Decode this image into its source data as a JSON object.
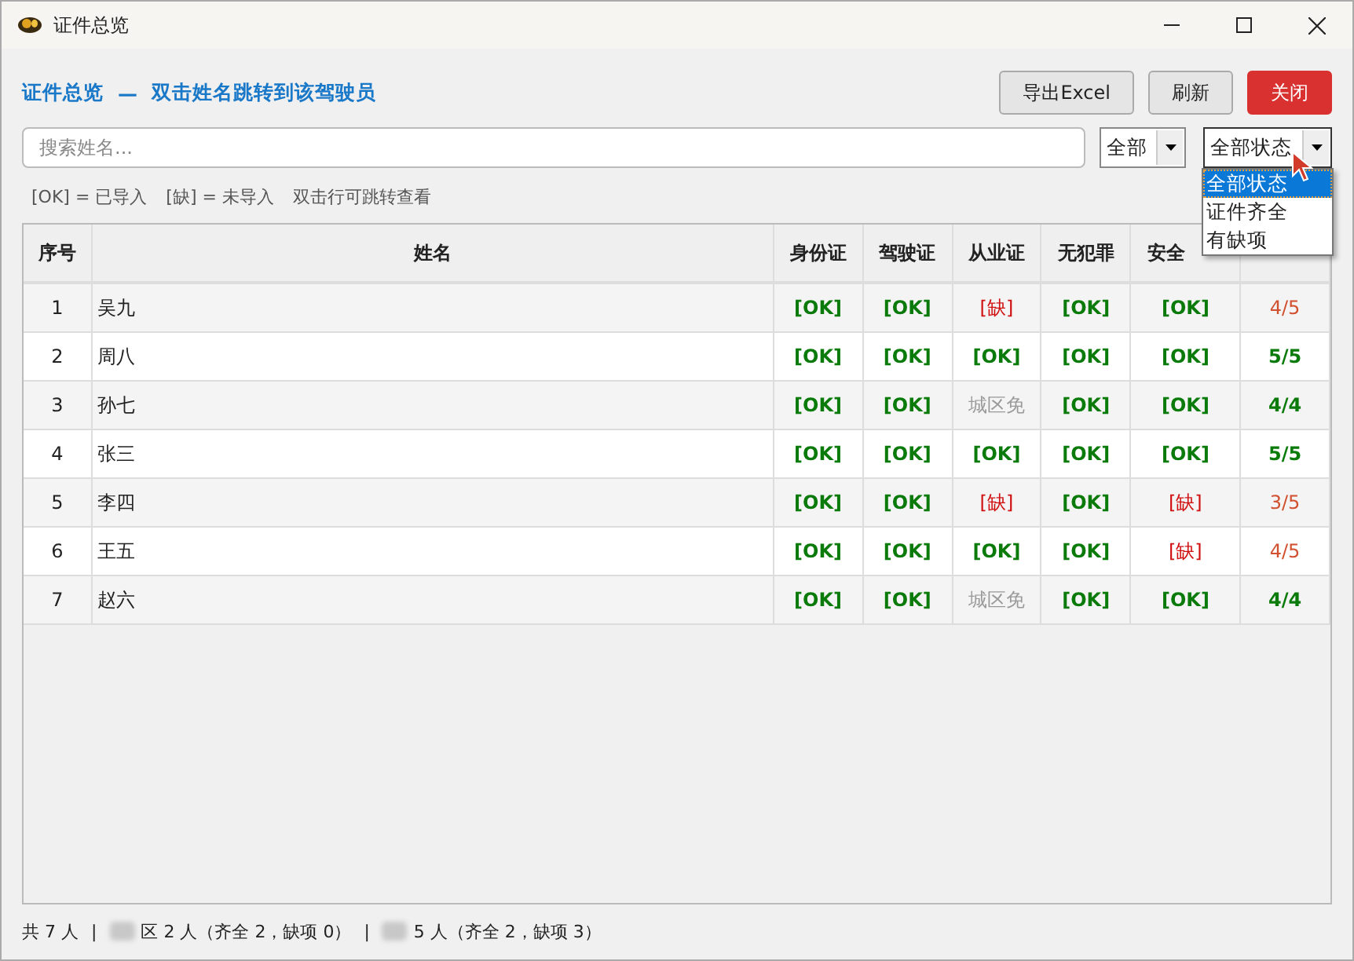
{
  "window": {
    "title": "证件总览"
  },
  "header": {
    "title": "证件总览",
    "separator": "—",
    "subtitle": "双击姓名跳转到该驾驶员"
  },
  "buttons": [
    {
      "label": "导出Excel",
      "kind": "normal"
    },
    {
      "label": "刷新",
      "kind": "normal"
    },
    {
      "label": "关闭",
      "kind": "danger"
    }
  ],
  "search": {
    "placeholder": "搜索姓名..."
  },
  "filters": [
    {
      "value": "全部",
      "expanded": false
    },
    {
      "value": "全部状态",
      "expanded": true,
      "options": [
        {
          "label": "全部状态",
          "selected": true
        },
        {
          "label": "证件齐全",
          "selected": false
        },
        {
          "label": "有缺项",
          "selected": false
        }
      ]
    }
  ],
  "legend": [
    "[OK] = 已导入",
    "[缺] = 未导入",
    "双击行可跳转查看"
  ],
  "table": {
    "columns": [
      "序号",
      "姓名",
      "身份证",
      "驾驶证",
      "从业证",
      "无犯罪",
      "安全"
    ],
    "rows": [
      {
        "cells": [
          {
            "text": "1",
            "kind": "index"
          },
          {
            "text": "吴九",
            "kind": "name"
          },
          {
            "text": "[OK]",
            "kind": "ok"
          },
          {
            "text": "[OK]",
            "kind": "ok"
          },
          {
            "text": "[缺]",
            "kind": "missing"
          },
          {
            "text": "[OK]",
            "kind": "ok"
          },
          {
            "text": "[OK]",
            "kind": "ok"
          },
          {
            "text": "4/5",
            "kind": "incomplete"
          }
        ]
      },
      {
        "cells": [
          {
            "text": "2",
            "kind": "index"
          },
          {
            "text": "周八",
            "kind": "name"
          },
          {
            "text": "[OK]",
            "kind": "ok"
          },
          {
            "text": "[OK]",
            "kind": "ok"
          },
          {
            "text": "[OK]",
            "kind": "ok"
          },
          {
            "text": "[OK]",
            "kind": "ok"
          },
          {
            "text": "[OK]",
            "kind": "ok"
          },
          {
            "text": "5/5",
            "kind": "complete"
          }
        ]
      },
      {
        "cells": [
          {
            "text": "3",
            "kind": "index"
          },
          {
            "text": "孙七",
            "kind": "name"
          },
          {
            "text": "[OK]",
            "kind": "ok"
          },
          {
            "text": "[OK]",
            "kind": "ok"
          },
          {
            "text": "城区免",
            "kind": "exempt"
          },
          {
            "text": "[OK]",
            "kind": "ok"
          },
          {
            "text": "[OK]",
            "kind": "ok"
          },
          {
            "text": "4/4",
            "kind": "complete"
          }
        ]
      },
      {
        "cells": [
          {
            "text": "4",
            "kind": "index"
          },
          {
            "text": "张三",
            "kind": "name"
          },
          {
            "text": "[OK]",
            "kind": "ok"
          },
          {
            "text": "[OK]",
            "kind": "ok"
          },
          {
            "text": "[OK]",
            "kind": "ok"
          },
          {
            "text": "[OK]",
            "kind": "ok"
          },
          {
            "text": "[OK]",
            "kind": "ok"
          },
          {
            "text": "5/5",
            "kind": "complete"
          }
        ]
      },
      {
        "cells": [
          {
            "text": "5",
            "kind": "index"
          },
          {
            "text": "李四",
            "kind": "name"
          },
          {
            "text": "[OK]",
            "kind": "ok"
          },
          {
            "text": "[OK]",
            "kind": "ok"
          },
          {
            "text": "[缺]",
            "kind": "missing"
          },
          {
            "text": "[OK]",
            "kind": "ok"
          },
          {
            "text": "[缺]",
            "kind": "missing"
          },
          {
            "text": "3/5",
            "kind": "incomplete"
          }
        ]
      },
      {
        "cells": [
          {
            "text": "6",
            "kind": "index"
          },
          {
            "text": "王五",
            "kind": "name"
          },
          {
            "text": "[OK]",
            "kind": "ok"
          },
          {
            "text": "[OK]",
            "kind": "ok"
          },
          {
            "text": "[OK]",
            "kind": "ok"
          },
          {
            "text": "[OK]",
            "kind": "ok"
          },
          {
            "text": "[缺]",
            "kind": "missing"
          },
          {
            "text": "4/5",
            "kind": "incomplete"
          }
        ]
      },
      {
        "cells": [
          {
            "text": "7",
            "kind": "index"
          },
          {
            "text": "赵六",
            "kind": "name"
          },
          {
            "text": "[OK]",
            "kind": "ok"
          },
          {
            "text": "[OK]",
            "kind": "ok"
          },
          {
            "text": "城区免",
            "kind": "exempt"
          },
          {
            "text": "[OK]",
            "kind": "ok"
          },
          {
            "text": "[OK]",
            "kind": "ok"
          },
          {
            "text": "4/4",
            "kind": "complete"
          }
        ]
      }
    ]
  },
  "status_bar": {
    "total": "共 7 人",
    "sep": "|",
    "groups": [
      "区 2 人（齐全 2，缺项 0）",
      "5 人（齐全 2，缺项 3）"
    ]
  }
}
